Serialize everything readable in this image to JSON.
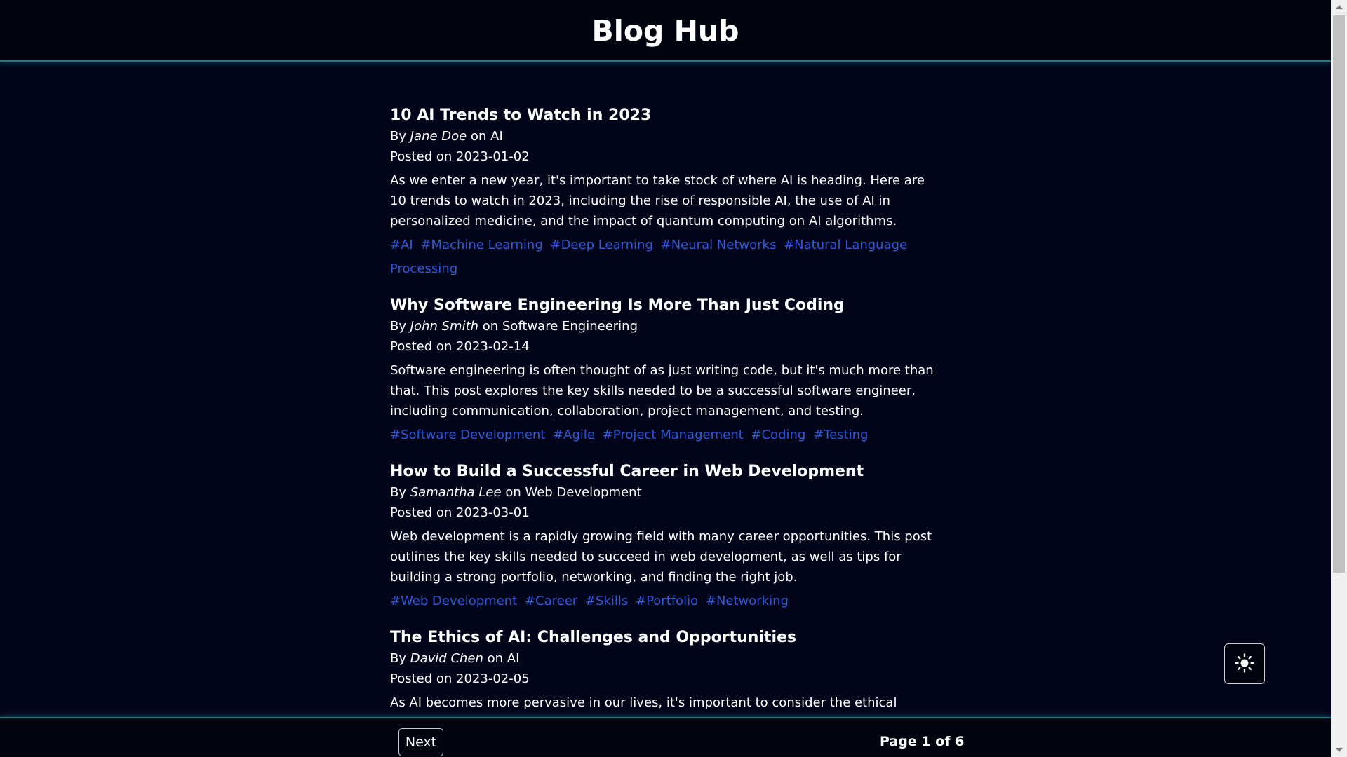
{
  "header": {
    "title": "Blog Hub"
  },
  "posts": [
    {
      "title": "10 AI Trends to Watch in 2023",
      "by": "By",
      "author": "Jane Doe",
      "on": "on",
      "category": "AI",
      "posted_prefix": "Posted on",
      "date": "2023-01-02",
      "excerpt": "As we enter a new year, it's important to take stock of where AI is heading. Here are 10 trends to watch in 2023, including the rise of responsible AI, the use of AI in personalized medicine, and the impact of quantum computing on AI algorithms.",
      "tags": [
        "#AI",
        "#Machine Learning",
        "#Deep Learning",
        "#Neural Networks",
        "#Natural Language Processing"
      ]
    },
    {
      "title": "Why Software Engineering Is More Than Just Coding",
      "by": "By",
      "author": "John Smith",
      "on": "on",
      "category": "Software Engineering",
      "posted_prefix": "Posted on",
      "date": "2023-02-14",
      "excerpt": "Software engineering is often thought of as just writing code, but it's much more than that. This post explores the key skills needed to be a successful software engineer, including communication, collaboration, project management, and testing.",
      "tags": [
        "#Software Development",
        "#Agile",
        "#Project Management",
        "#Coding",
        "#Testing"
      ]
    },
    {
      "title": "How to Build a Successful Career in Web Development",
      "by": "By",
      "author": "Samantha Lee",
      "on": "on",
      "category": "Web Development",
      "posted_prefix": "Posted on",
      "date": "2023-03-01",
      "excerpt": "Web development is a rapidly growing field with many career opportunities. This post outlines the key skills needed to succeed in web development, as well as tips for building a strong portfolio, networking, and finding the right job.",
      "tags": [
        "#Web Development",
        "#Career",
        "#Skills",
        "#Portfolio",
        "#Networking"
      ]
    },
    {
      "title": "The Ethics of AI: Challenges and Opportunities",
      "by": "By",
      "author": "David Chen",
      "on": "on",
      "category": "AI",
      "posted_prefix": "Posted on",
      "date": "2023-02-05",
      "excerpt": "As AI becomes more pervasive in our lives, it's important to consider the ethical",
      "tags": []
    }
  ],
  "pagination": {
    "next_label": "Next",
    "page_text": "Page 1 of 6"
  },
  "theme_toggle": {
    "icon": "sun-icon"
  },
  "colors": {
    "background": "#02051a",
    "header_bg": "#01040f",
    "accent_border": "#1e7d84",
    "tag_link": "#2f59d6",
    "text": "#ffffff"
  }
}
